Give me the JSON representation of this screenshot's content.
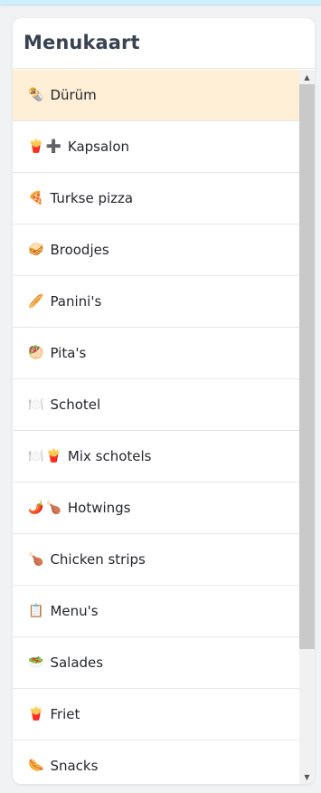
{
  "menu": {
    "title": "Menukaart",
    "items": [
      {
        "icons": [
          "🌯"
        ],
        "label": "Dürüm",
        "active": true
      },
      {
        "icons": [
          "🍟",
          "➕"
        ],
        "label": "Kapsalon",
        "active": false
      },
      {
        "icons": [
          "🍕"
        ],
        "label": "Turkse pizza",
        "active": false
      },
      {
        "icons": [
          "🥪"
        ],
        "label": "Broodjes",
        "active": false
      },
      {
        "icons": [
          "🥖"
        ],
        "label": "Panini's",
        "active": false
      },
      {
        "icons": [
          "🥙"
        ],
        "label": "Pita's",
        "active": false
      },
      {
        "icons": [
          "🍽️"
        ],
        "label": "Schotel",
        "active": false
      },
      {
        "icons": [
          "🍽️",
          "🍟"
        ],
        "label": "Mix schotels",
        "active": false
      },
      {
        "icons": [
          "🌶️",
          "🍗"
        ],
        "label": "Hotwings",
        "active": false
      },
      {
        "icons": [
          "🍗"
        ],
        "label": "Chicken strips",
        "active": false
      },
      {
        "icons": [
          "📋"
        ],
        "label": "Menu's",
        "active": false
      },
      {
        "icons": [
          "🥗"
        ],
        "label": "Salades",
        "active": false
      },
      {
        "icons": [
          "🍟"
        ],
        "label": "Friet",
        "active": false
      },
      {
        "icons": [
          "🌭"
        ],
        "label": "Snacks",
        "active": false
      }
    ]
  },
  "scrollbar": {
    "up_glyph": "▲",
    "down_glyph": "▼"
  },
  "colors": {
    "active_item_bg": "#ffefd6",
    "top_strip": "#cdeefc",
    "title": "#3a4150"
  }
}
